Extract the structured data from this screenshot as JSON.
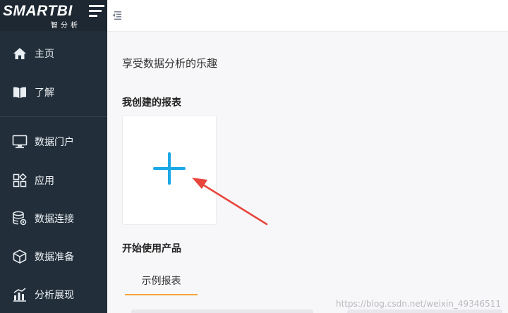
{
  "brand": {
    "name": "SMARTBI",
    "subtitle": "智分析"
  },
  "sidebar": {
    "items": [
      {
        "label": "主页",
        "icon": "home-icon"
      },
      {
        "label": "了解",
        "icon": "book-icon"
      },
      {
        "label": "数据门户",
        "icon": "monitor-icon"
      },
      {
        "label": "应用",
        "icon": "apps-icon"
      },
      {
        "label": "数据连接",
        "icon": "database-gear-icon"
      },
      {
        "label": "数据准备",
        "icon": "cube-icon"
      },
      {
        "label": "分析展现",
        "icon": "bar-chart-icon"
      }
    ]
  },
  "main": {
    "slogan": "享受数据分析的乐趣",
    "my_reports_title": "我创建的报表",
    "get_started_title": "开始使用产品",
    "tabs": [
      {
        "label": "示例报表",
        "active": true
      }
    ]
  },
  "watermark": "https://blog.csdn.net/weixin_49346511",
  "colors": {
    "sidebar_bg": "#222f3b",
    "accent_blue": "#1ba8e6",
    "tab_underline": "#f2a63a",
    "annotation_arrow": "#e8453c"
  }
}
